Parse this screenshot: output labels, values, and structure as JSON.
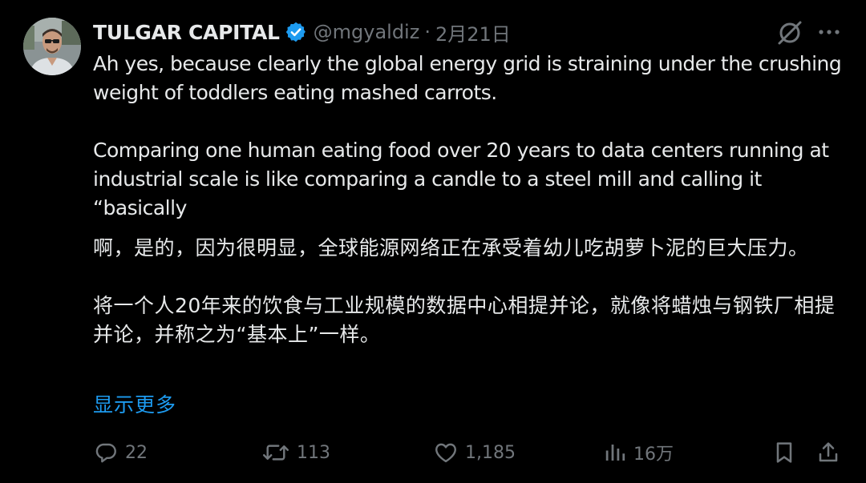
{
  "author": {
    "display_name": "TULGAR CAPITAL",
    "handle": "@mgyaldiz",
    "separator": "·",
    "date": "2月21日"
  },
  "tweet": {
    "paragraphs": [
      "Ah yes, because clearly the global energy grid is straining under the crushing weight of toddlers eating mashed carrots.",
      "Comparing one human eating food over 20 years to data centers running at industrial scale is like comparing a candle to a steel mill and calling it “basically"
    ],
    "translation_paragraphs": [
      "啊，是的，因为很明显，全球能源网络正在承受着幼儿吃胡萝卜泥的巨大压力。",
      "将一个人20年来的饮食与工业规模的数据中心相提并论，就像将蜡烛与钢铁厂相提并论，并称之为“基本上”一样。"
    ],
    "show_more_label": "显示更多"
  },
  "actions": {
    "replies": "22",
    "reposts": "113",
    "likes": "1,185",
    "views": "16万"
  },
  "colors": {
    "background": "#000000",
    "text": "#e7e9ea",
    "secondary": "#71767b",
    "link": "#1d9bf0",
    "verified": "#1d9bf0"
  },
  "icons": {
    "verified": "verified-badge-icon",
    "grok": "grok-icon",
    "more": "more-icon",
    "reply": "reply-icon",
    "repost": "repost-icon",
    "like": "like-icon",
    "views": "views-icon",
    "bookmark": "bookmark-icon",
    "share": "share-icon"
  }
}
